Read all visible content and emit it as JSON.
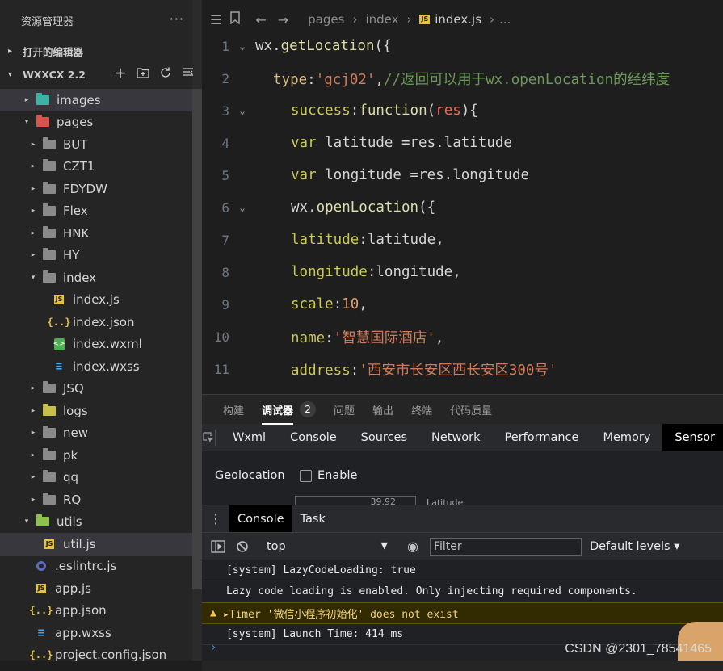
{
  "sidebar": {
    "title": "资源管理器",
    "more": "···",
    "open_editors": "打开的编辑器",
    "project": "WXXCX 2.2",
    "tree": [
      {
        "label": "images",
        "type": "folder",
        "color": "teal",
        "depth": 1,
        "arrow": "▸"
      },
      {
        "label": "pages",
        "type": "folder",
        "color": "red",
        "depth": 1,
        "arrow": "▾"
      },
      {
        "label": "BUT",
        "type": "folder",
        "color": "grey",
        "depth": 2,
        "arrow": "▸"
      },
      {
        "label": "CZT1",
        "type": "folder",
        "color": "grey",
        "depth": 2,
        "arrow": "▸"
      },
      {
        "label": "FDYDW",
        "type": "folder",
        "color": "grey",
        "depth": 2,
        "arrow": "▸"
      },
      {
        "label": "Flex",
        "type": "folder",
        "color": "grey",
        "depth": 2,
        "arrow": "▸"
      },
      {
        "label": "HNK",
        "type": "folder",
        "color": "grey",
        "depth": 2,
        "arrow": "▸"
      },
      {
        "label": "HY",
        "type": "folder",
        "color": "grey",
        "depth": 2,
        "arrow": "▸"
      },
      {
        "label": "index",
        "type": "folder",
        "color": "grey",
        "depth": 2,
        "arrow": "▾"
      },
      {
        "label": "index.js",
        "type": "js",
        "depth": 3
      },
      {
        "label": "index.json",
        "type": "json",
        "depth": 3
      },
      {
        "label": "index.wxml",
        "type": "wxml",
        "depth": 3
      },
      {
        "label": "index.wxss",
        "type": "css",
        "depth": 3
      },
      {
        "label": "JSQ",
        "type": "folder",
        "color": "grey",
        "depth": 2,
        "arrow": "▸"
      },
      {
        "label": "logs",
        "type": "folder",
        "color": "yellow",
        "depth": 2,
        "arrow": "▸"
      },
      {
        "label": "new",
        "type": "folder",
        "color": "grey",
        "depth": 2,
        "arrow": "▸"
      },
      {
        "label": "pk",
        "type": "folder",
        "color": "grey",
        "depth": 2,
        "arrow": "▸"
      },
      {
        "label": "qq",
        "type": "folder",
        "color": "grey",
        "depth": 2,
        "arrow": "▸"
      },
      {
        "label": "RQ",
        "type": "folder",
        "color": "grey",
        "depth": 2,
        "arrow": "▸"
      },
      {
        "label": "utils",
        "type": "folder",
        "color": "green",
        "depth": 1,
        "arrow": "▾"
      },
      {
        "label": "util.js",
        "type": "js",
        "depth": 2
      },
      {
        "label": ".eslintrc.js",
        "type": "dot",
        "depth": 1
      },
      {
        "label": "app.js",
        "type": "js",
        "depth": 1
      },
      {
        "label": "app.json",
        "type": "json",
        "depth": 1
      },
      {
        "label": "app.wxss",
        "type": "css",
        "depth": 1
      },
      {
        "label": "project.config.json",
        "type": "json",
        "depth": 1
      }
    ]
  },
  "editor": {
    "breadcrumb": [
      "pages",
      "index",
      "index.js",
      "..."
    ],
    "lines": [
      {
        "n": "1",
        "indent": 0,
        "fold": "⌄",
        "tokens": [
          [
            "plain",
            "wx."
          ],
          [
            "fn",
            "getLocation"
          ],
          [
            "punc",
            "({"
          ]
        ]
      },
      {
        "n": "2",
        "indent": 1,
        "fold": "",
        "tokens": [
          [
            "key",
            "type"
          ],
          [
            "punc",
            ":"
          ],
          [
            "str",
            "'gcj02'"
          ],
          [
            "punc",
            ","
          ],
          [
            "comment",
            "//返回可以用于wx.openLocation的经纬度"
          ]
        ]
      },
      {
        "n": "3",
        "indent": 2,
        "fold": "⌄",
        "tokens": [
          [
            "prop",
            "success"
          ],
          [
            "punc",
            ":"
          ],
          [
            "fn",
            "function"
          ],
          [
            "punc",
            "("
          ],
          [
            "red",
            "res"
          ],
          [
            "punc",
            "){"
          ]
        ]
      },
      {
        "n": "4",
        "indent": 2,
        "fold": "",
        "tokens": [
          [
            "prop",
            "var"
          ],
          [
            "plain",
            " latitude "
          ],
          [
            "punc",
            "="
          ],
          [
            "plain",
            "res.latitude"
          ]
        ]
      },
      {
        "n": "5",
        "indent": 2,
        "fold": "",
        "tokens": [
          [
            "prop",
            "var"
          ],
          [
            "plain",
            " longitude "
          ],
          [
            "punc",
            "="
          ],
          [
            "plain",
            "res.longitude"
          ]
        ]
      },
      {
        "n": "6",
        "indent": 2,
        "fold": "⌄",
        "tokens": [
          [
            "plain",
            "wx."
          ],
          [
            "fn",
            "openLocation"
          ],
          [
            "punc",
            "({"
          ]
        ]
      },
      {
        "n": "7",
        "indent": 2,
        "fold": "",
        "tokens": [
          [
            "prop",
            "latitude"
          ],
          [
            "punc",
            ":"
          ],
          [
            "plain",
            "latitude"
          ],
          [
            "punc",
            ","
          ]
        ]
      },
      {
        "n": "8",
        "indent": 2,
        "fold": "",
        "tokens": [
          [
            "prop",
            "longitude"
          ],
          [
            "punc",
            ":"
          ],
          [
            "plain",
            "longitude"
          ],
          [
            "punc",
            ","
          ]
        ]
      },
      {
        "n": "9",
        "indent": 2,
        "fold": "",
        "tokens": [
          [
            "prop",
            "scale"
          ],
          [
            "punc",
            ":"
          ],
          [
            "num",
            "10"
          ],
          [
            "punc",
            ","
          ]
        ]
      },
      {
        "n": "10",
        "indent": 2,
        "fold": "",
        "tokens": [
          [
            "prop",
            "name"
          ],
          [
            "punc",
            ":"
          ],
          [
            "str",
            "'智慧国际酒店'"
          ],
          [
            "punc",
            ","
          ]
        ]
      },
      {
        "n": "11",
        "indent": 2,
        "fold": "",
        "tokens": [
          [
            "prop",
            "address"
          ],
          [
            "punc",
            ":"
          ],
          [
            "str",
            "'西安市长安区西长安区300号'"
          ]
        ]
      }
    ]
  },
  "panel": {
    "tabs": [
      "构建",
      "调试器",
      "问题",
      "输出",
      "终端",
      "代码质量"
    ],
    "active_tab": "调试器",
    "debugger_count": "2",
    "devtools_tabs": [
      "Wxml",
      "Console",
      "Sources",
      "Network",
      "Performance",
      "Memory",
      "Sensor"
    ],
    "active_devtools_tab": "Sensor",
    "sensor": {
      "geolocation_label": "Geolocation",
      "enable_label": "Enable",
      "lat_value": "39.92",
      "lat_label": "Latitude"
    },
    "console_tabs": [
      "Console",
      "Task"
    ],
    "context": "top",
    "filter_placeholder": "Filter",
    "levels": "Default levels ▾",
    "logs": [
      {
        "level": "info",
        "text": "[system] LazyCodeLoading: true"
      },
      {
        "level": "info",
        "text": "Lazy code loading is enabled. Only injecting required components."
      },
      {
        "level": "warn",
        "text": "▸Timer '微信小程序初始化' does not exist"
      },
      {
        "level": "info",
        "text": "[system] Launch Time: 414 ms"
      }
    ],
    "prompt": "›"
  },
  "watermark": "CSDN @2301_78541465"
}
